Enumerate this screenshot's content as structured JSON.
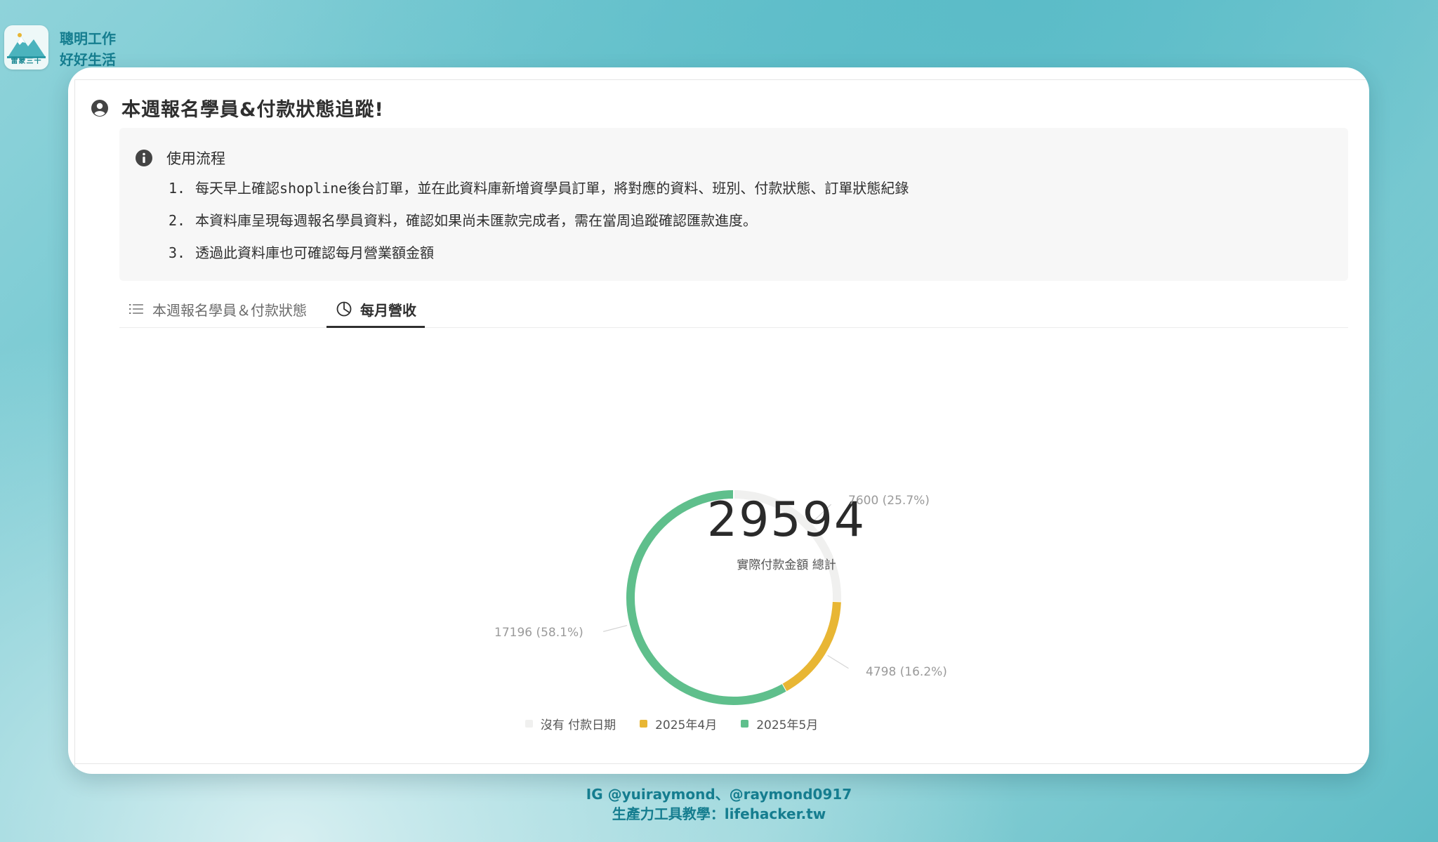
{
  "brand": {
    "logo_caption": "雷蒙三十",
    "line1": "聰明工作",
    "line2": "好好生活"
  },
  "page": {
    "title": "本週報名學員&付款狀態追蹤!"
  },
  "callout": {
    "title": "使用流程",
    "steps": [
      {
        "num": "1.",
        "text": "每天早上確認shopline後台訂單，並在此資料庫新增資學員訂單，將對應的資料、班別、付款狀態、訂單狀態紀錄"
      },
      {
        "num": "2.",
        "text": "本資料庫呈現每週報名學員資料，確認如果尚未匯款完成者，需在當周追蹤確認匯款進度。"
      },
      {
        "num": "3.",
        "text": "透過此資料庫也可確認每月營業額金額"
      }
    ]
  },
  "tabs": [
    {
      "label": "本週報名學員＆付款狀態",
      "icon": "list-icon",
      "active": false
    },
    {
      "label": "每月營收",
      "icon": "pie-chart-icon",
      "active": true
    }
  ],
  "chart_data": {
    "type": "pie",
    "total": 29594,
    "total_label": "實際付款金額 總計",
    "slices": [
      {
        "name": "沒有 付款日期",
        "value": 7600,
        "label": "7600 (25.7%)",
        "color": "#f0f0ef"
      },
      {
        "name": "2025年4月",
        "value": 4798,
        "label": "4798 (16.2%)",
        "color": "#e8b634"
      },
      {
        "name": "2025年5月",
        "value": 17196,
        "label": "17196 (58.1%)",
        "color": "#5fbf8c"
      }
    ],
    "legend_position": "bottom"
  },
  "footer": {
    "line1": "IG @yuiraymond、@raymond0917",
    "line2": "生產力工具教學：lifehacker.tw"
  }
}
